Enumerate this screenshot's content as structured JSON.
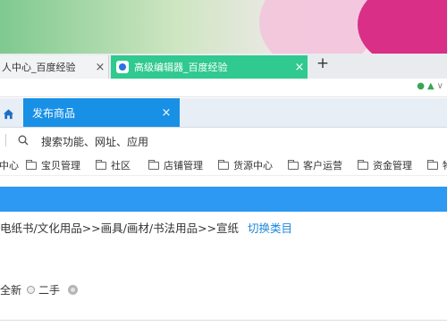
{
  "browser": {
    "tabs": [
      {
        "title": "人中心_百度经验",
        "close": "×"
      },
      {
        "title": "高级编辑器_百度经验",
        "close": "×"
      }
    ],
    "new_tab_label": "+"
  },
  "app_tabs": {
    "active_tab": {
      "title": "发布商品",
      "close": "×"
    }
  },
  "search": {
    "label": "搜索功能、网址、应用"
  },
  "nav": {
    "items": [
      {
        "label": "中心"
      },
      {
        "label": "宝贝管理"
      },
      {
        "label": "社区"
      },
      {
        "label": "店铺管理"
      },
      {
        "label": "货源中心"
      },
      {
        "label": "客户运营"
      },
      {
        "label": "资金管理"
      },
      {
        "label": "物"
      }
    ]
  },
  "category": {
    "path": "电纸书/文化用品>>画具/画材/书法用品>>宣纸",
    "switch_label": "切换类目"
  },
  "condition": {
    "options": [
      {
        "label": "全新"
      },
      {
        "label": "二手"
      }
    ]
  },
  "colors": {
    "active_browser_tab": "#30c98f",
    "app_blue": "#1890e6",
    "banner_blue": "#2d99f2",
    "link_blue": "#1d87d9"
  }
}
